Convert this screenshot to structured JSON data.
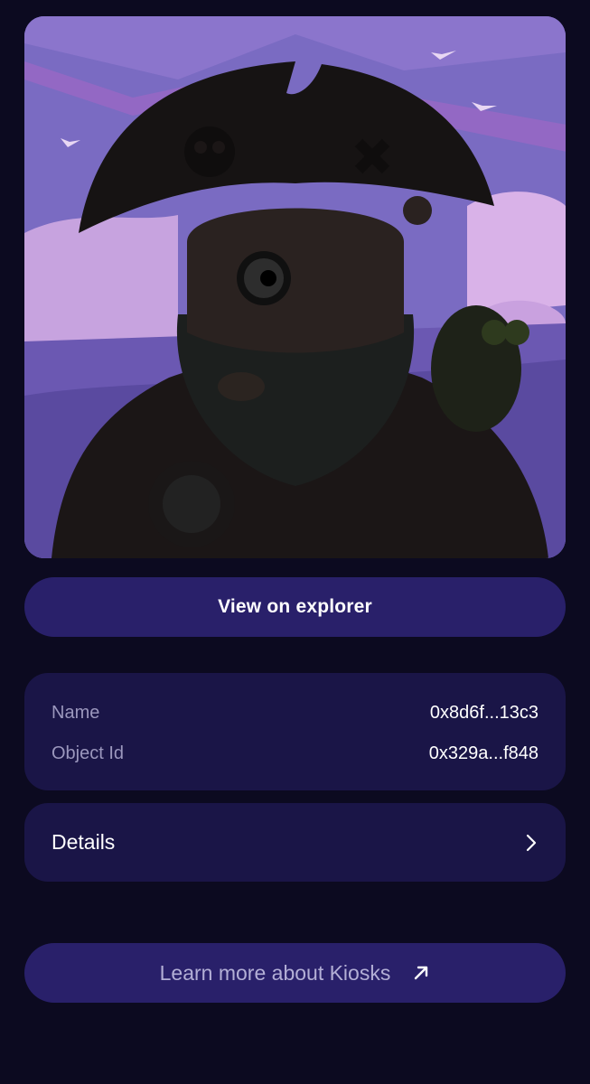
{
  "nft": {
    "image_name": "pirate-captain-artwork"
  },
  "actions": {
    "view_explorer_label": "View on explorer",
    "learn_more_label": "Learn more about Kiosks"
  },
  "info": {
    "rows": [
      {
        "label": "Name",
        "value": "0x8d6f...13c3"
      },
      {
        "label": "Object Id",
        "value": "0x329a...f848"
      }
    ]
  },
  "details": {
    "label": "Details"
  },
  "icons": {
    "details_chevron": "chevron-right-icon",
    "external_link": "arrow-up-right-icon"
  },
  "colors": {
    "background": "#0c0a20",
    "card": "#1a1547",
    "button": "#29206a",
    "label": "#9b97bd",
    "link_text": "#b3afd6"
  }
}
